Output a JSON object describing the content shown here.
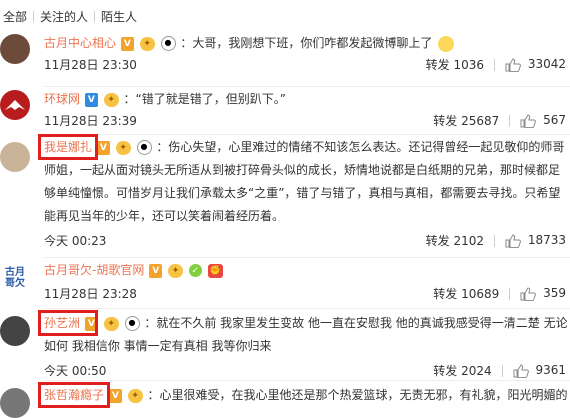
{
  "tabs": [
    "全部",
    "关注的人",
    "陌生人"
  ],
  "comments": [
    {
      "user": "古月中心相心",
      "badges": [
        "V",
        "gold",
        "pig"
      ],
      "text": "：大哥，我刚想下班，你们咋都发起微博聊上了",
      "time": "11月28日 23:30",
      "repost": "转发 1036",
      "likes": "33042",
      "avatar_color": "#6d4b3b"
    },
    {
      "user": "环球网",
      "badges": [
        "Vb",
        "gold"
      ],
      "text": "：“错了就是错了，但别趴下。”",
      "time": "11月28日 23:39",
      "repost": "转发 25687",
      "likes": "567",
      "avatar_color": "#b91c1c"
    },
    {
      "user": "我是娜扎",
      "badges": [
        "V",
        "gold",
        "pig"
      ],
      "lines": [
        "：伤心失望，心里难过的情绪不知该怎么表达。还记得曾经一起见敬仰的师哥",
        "师姐，一起从面对镜头无所适从到被打碎骨头似的成长，矫情地说都是白纸期的兄弟，那时候都足",
        "够单纯憧憬。可惜岁月让我们承载太多“之重”，错了与错了，真相与真相，都需要去寻找。只希望",
        "能再见当年的少年，还可以笑着闹着经历着。"
      ],
      "time": "今天 00:23",
      "repost": "转发 2102",
      "likes": "18733",
      "avatar_color": "#c9b49a"
    },
    {
      "user": "古月哥欠-胡歌官网",
      "badges": [
        "V",
        "gold",
        "red",
        "green"
      ],
      "text": "",
      "time": "11月28日 23:28",
      "repost": "转发 10689",
      "likes": "359",
      "avatar_color": "#2a5aa8",
      "avatar_text": "古月\n哥欠"
    },
    {
      "user": "孙艺洲",
      "badges": [
        "V",
        "gold",
        "pig"
      ],
      "lines": [
        "：就在不久前 我家里发生变故 他一直在安慰我 他的真诚我感受得一清二楚 无论",
        "如何 我相信你 事情一定有真相 我等你归来"
      ],
      "time": "今天 00:50",
      "repost": "转发 2024",
      "likes": "9361",
      "avatar_color": "#444"
    },
    {
      "user": "张哲瀚瘾子",
      "badges": [
        "V",
        "gold"
      ],
      "text": "：心里很难受，在我心里他还是那个热爱篮球，无责无邪，有礼貌，阳光明媚的",
      "time": "",
      "repost": "",
      "likes": "",
      "avatar_color": "#777"
    }
  ],
  "colors": {
    "username": "#eb7350",
    "highlight_box": "#e21f1f"
  }
}
